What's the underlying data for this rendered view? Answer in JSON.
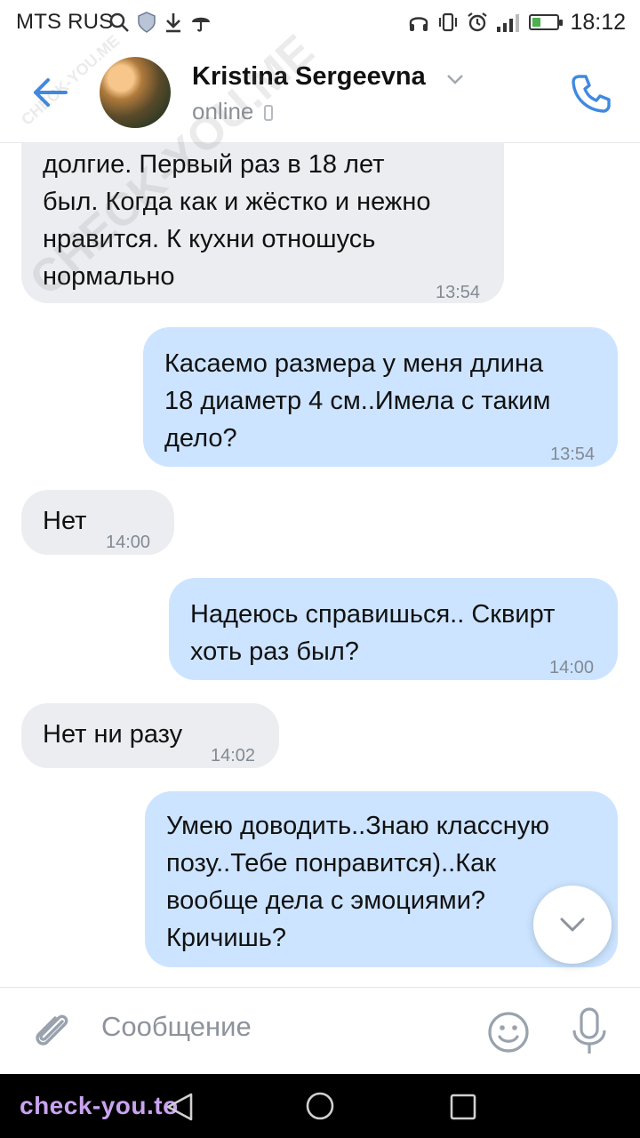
{
  "status_bar": {
    "carrier": "MTS RUS",
    "time": "18:12",
    "battery_level": 0.35,
    "icons": [
      "search-icon",
      "shield-icon",
      "download-icon",
      "umbrella-icon",
      "headphones-icon",
      "vibrate-icon",
      "alarm-icon",
      "signal-icon",
      "battery-icon"
    ]
  },
  "header": {
    "contact_name": "Kristina Sergeevna",
    "status": "online",
    "icons": [
      "back-arrow-icon",
      "chevron-down-icon",
      "mobile-icon",
      "phone-icon"
    ]
  },
  "messages": [
    {
      "side": "in",
      "text": "долгие. Первый раз в 18 лет\nбыл. Когда как и жёстко и нежно\nнравится. К кухни отношусь\nнормально",
      "time": "13:54"
    },
    {
      "side": "out",
      "text": "Касаемо размера у меня длина\n18 диаметр 4 см..Имела с таким\nдело?",
      "time": "13:54"
    },
    {
      "side": "in",
      "text": "Нет",
      "time": "14:00"
    },
    {
      "side": "out",
      "text": "Надеюсь справишься.. Сквирт\nхоть раз был?",
      "time": "14:00"
    },
    {
      "side": "in",
      "text": "Нет ни разу",
      "time": "14:02"
    },
    {
      "side": "out",
      "text": "Умею доводить..Знаю классную\nпозу..Тебе понравится)..Как\nвообще дела с эмоциями?\nКричишь?",
      "time": ""
    }
  ],
  "composer": {
    "placeholder": "Сообщение",
    "icons": [
      "paperclip-icon",
      "smile-icon",
      "microphone-icon"
    ]
  },
  "scroll_button": {
    "icon": "chevron-down-icon"
  },
  "nav_bar": {
    "brand": "check-you.to",
    "icons": [
      "nav-back-icon",
      "nav-home-icon",
      "nav-recent-icon"
    ]
  },
  "watermark": {
    "text": "CHECK-YOU.ME"
  },
  "colors": {
    "accent": "#3f8ae0",
    "incoming_bubble": "#ebedf0",
    "outgoing_bubble": "#cce4ff",
    "brand_text": "#c9a3f0"
  }
}
